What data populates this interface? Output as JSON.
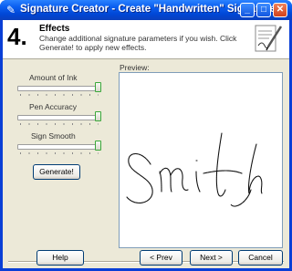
{
  "window": {
    "title": "Signature Creator - Create \"Handwritten\" Signature",
    "controls": {
      "minimize": "_",
      "maximize": "□",
      "close": "✕"
    }
  },
  "header": {
    "step_number": "4.",
    "step_title": "Effects",
    "description": "Change additional signature parameters if you wish. Click Generate! to apply new effects."
  },
  "controls": {
    "sliders": [
      {
        "label": "Amount of Ink",
        "value": 1.0
      },
      {
        "label": "Pen Accuracy",
        "value": 1.0
      },
      {
        "label": "Sign Smooth",
        "value": 1.0
      }
    ],
    "generate_label": "Generate!"
  },
  "preview": {
    "label": "Preview:",
    "signature_text": "Smith"
  },
  "footer": {
    "help_label": "Help",
    "prev_label": "< Prev",
    "next_label": "Next >",
    "cancel_label": "Cancel"
  },
  "colors": {
    "titlebar": "#0a5ef0",
    "face": "#ece9d8",
    "slider_thumb_border": "#3aa83a"
  }
}
